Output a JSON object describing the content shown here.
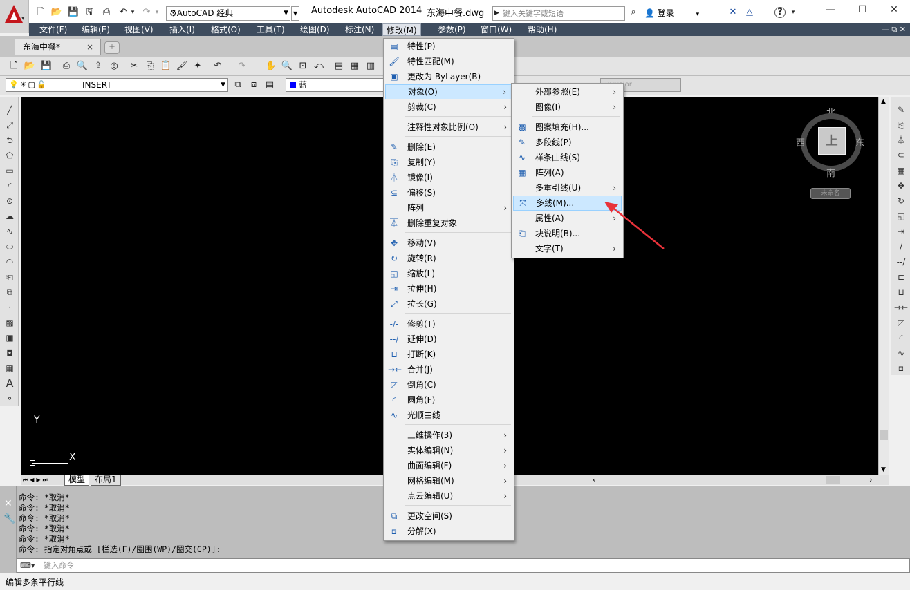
{
  "titlebar": {
    "workspace": "AutoCAD 经典",
    "app_title": "Autodesk AutoCAD 2014",
    "file_name": "东海中餐.dwg",
    "search_placeholder": "键入关键字或短语",
    "login": "登录"
  },
  "menubar": {
    "items": [
      "文件(F)",
      "编辑(E)",
      "视图(V)",
      "插入(I)",
      "格式(O)",
      "工具(T)",
      "绘图(D)",
      "标注(N)",
      "修改(M)",
      "参数(P)",
      "窗口(W)",
      "帮助(H)"
    ],
    "active_index": 8
  },
  "doc_tab": {
    "label": "东海中餐*",
    "close": "×"
  },
  "layer": {
    "name": "INSERT"
  },
  "color": {
    "name": "蓝",
    "swatch": "#0000ff"
  },
  "viewcube": {
    "north": "北",
    "south": "南",
    "west": "西",
    "east": "东",
    "face": "上",
    "name": "未命名"
  },
  "ucs": {
    "x": "X",
    "y": "Y"
  },
  "layout_tabs": [
    "模型",
    "布局1"
  ],
  "modify_menu": {
    "items": [
      {
        "label": "特性(P)",
        "icon": "properties-icon"
      },
      {
        "label": "特性匹配(M)",
        "icon": "match-properties-icon"
      },
      {
        "label": "更改为 ByLayer(B)",
        "icon": "bylayer-icon"
      },
      {
        "label": "对象(O)",
        "submenu": true,
        "highlighted": true
      },
      {
        "label": "剪裁(C)",
        "submenu": true
      },
      {
        "label": "注释性对象比例(O)",
        "submenu": true
      },
      {
        "label": "删除(E)",
        "icon": "erase-icon"
      },
      {
        "label": "复制(Y)",
        "icon": "copy-icon"
      },
      {
        "label": "镜像(I)",
        "icon": "mirror-icon"
      },
      {
        "label": "偏移(S)",
        "icon": "offset-icon"
      },
      {
        "label": "阵列",
        "submenu": true
      },
      {
        "label": "删除重复对象",
        "icon": "overkill-icon"
      },
      {
        "label": "移动(V)",
        "icon": "move-icon"
      },
      {
        "label": "旋转(R)",
        "icon": "rotate-icon"
      },
      {
        "label": "缩放(L)",
        "icon": "scale-icon"
      },
      {
        "label": "拉伸(H)",
        "icon": "stretch-icon"
      },
      {
        "label": "拉长(G)",
        "icon": "lengthen-icon"
      },
      {
        "label": "修剪(T)",
        "icon": "trim-icon"
      },
      {
        "label": "延伸(D)",
        "icon": "extend-icon"
      },
      {
        "label": "打断(K)",
        "icon": "break-icon"
      },
      {
        "label": "合并(J)",
        "icon": "join-icon"
      },
      {
        "label": "倒角(C)",
        "icon": "chamfer-icon"
      },
      {
        "label": "圆角(F)",
        "icon": "fillet-icon"
      },
      {
        "label": "光顺曲线",
        "icon": "blend-curves-icon"
      },
      {
        "label": "三维操作(3)",
        "submenu": true
      },
      {
        "label": "实体编辑(N)",
        "submenu": true
      },
      {
        "label": "曲面编辑(F)",
        "submenu": true
      },
      {
        "label": "网格编辑(M)",
        "submenu": true
      },
      {
        "label": "点云编辑(U)",
        "submenu": true
      },
      {
        "label": "更改空间(S)",
        "icon": "change-space-icon"
      },
      {
        "label": "分解(X)",
        "icon": "explode-icon"
      }
    ]
  },
  "object_menu": {
    "items": [
      {
        "label": "外部参照(E)",
        "submenu": true
      },
      {
        "label": "图像(I)",
        "submenu": true
      },
      {
        "label": "图案填充(H)...",
        "icon": "hatch-edit-icon"
      },
      {
        "label": "多段线(P)",
        "icon": "polyline-edit-icon"
      },
      {
        "label": "样条曲线(S)",
        "icon": "spline-edit-icon"
      },
      {
        "label": "阵列(A)",
        "icon": "array-edit-icon"
      },
      {
        "label": "多重引线(U)",
        "submenu": true
      },
      {
        "label": "多线(M)...",
        "icon": "multiline-edit-icon",
        "highlighted": true
      },
      {
        "label": "属性(A)",
        "submenu": true
      },
      {
        "label": "块说明(B)...",
        "icon": "block-description-icon"
      },
      {
        "label": "文字(T)",
        "submenu": true
      }
    ]
  },
  "command": {
    "history": [
      "命令: *取消*",
      "命令: *取消*",
      "命令: *取消*",
      "命令: *取消*",
      "命令: *取消*",
      "命令: 指定对角点或 [栏选(F)/圈围(WP)/圈交(CP)]:"
    ],
    "placeholder": "键入命令"
  },
  "status": {
    "text": "编辑多条平行线"
  },
  "colors": {
    "menubar": "#3e4c5e",
    "canvas": "#000000",
    "highlight": "#cce8ff",
    "annotation_arrow": "#e8323a"
  }
}
